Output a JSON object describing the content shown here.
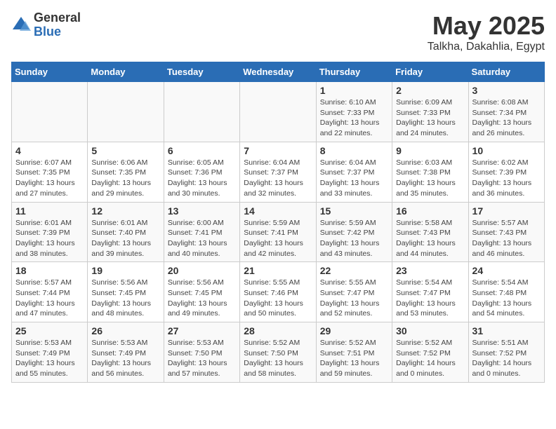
{
  "header": {
    "logo_general": "General",
    "logo_blue": "Blue",
    "month": "May 2025",
    "location": "Talkha, Dakahlia, Egypt"
  },
  "weekdays": [
    "Sunday",
    "Monday",
    "Tuesday",
    "Wednesday",
    "Thursday",
    "Friday",
    "Saturday"
  ],
  "weeks": [
    [
      {
        "day": "",
        "info": ""
      },
      {
        "day": "",
        "info": ""
      },
      {
        "day": "",
        "info": ""
      },
      {
        "day": "",
        "info": ""
      },
      {
        "day": "1",
        "info": "Sunrise: 6:10 AM\nSunset: 7:33 PM\nDaylight: 13 hours\nand 22 minutes."
      },
      {
        "day": "2",
        "info": "Sunrise: 6:09 AM\nSunset: 7:33 PM\nDaylight: 13 hours\nand 24 minutes."
      },
      {
        "day": "3",
        "info": "Sunrise: 6:08 AM\nSunset: 7:34 PM\nDaylight: 13 hours\nand 26 minutes."
      }
    ],
    [
      {
        "day": "4",
        "info": "Sunrise: 6:07 AM\nSunset: 7:35 PM\nDaylight: 13 hours\nand 27 minutes."
      },
      {
        "day": "5",
        "info": "Sunrise: 6:06 AM\nSunset: 7:35 PM\nDaylight: 13 hours\nand 29 minutes."
      },
      {
        "day": "6",
        "info": "Sunrise: 6:05 AM\nSunset: 7:36 PM\nDaylight: 13 hours\nand 30 minutes."
      },
      {
        "day": "7",
        "info": "Sunrise: 6:04 AM\nSunset: 7:37 PM\nDaylight: 13 hours\nand 32 minutes."
      },
      {
        "day": "8",
        "info": "Sunrise: 6:04 AM\nSunset: 7:37 PM\nDaylight: 13 hours\nand 33 minutes."
      },
      {
        "day": "9",
        "info": "Sunrise: 6:03 AM\nSunset: 7:38 PM\nDaylight: 13 hours\nand 35 minutes."
      },
      {
        "day": "10",
        "info": "Sunrise: 6:02 AM\nSunset: 7:39 PM\nDaylight: 13 hours\nand 36 minutes."
      }
    ],
    [
      {
        "day": "11",
        "info": "Sunrise: 6:01 AM\nSunset: 7:39 PM\nDaylight: 13 hours\nand 38 minutes."
      },
      {
        "day": "12",
        "info": "Sunrise: 6:01 AM\nSunset: 7:40 PM\nDaylight: 13 hours\nand 39 minutes."
      },
      {
        "day": "13",
        "info": "Sunrise: 6:00 AM\nSunset: 7:41 PM\nDaylight: 13 hours\nand 40 minutes."
      },
      {
        "day": "14",
        "info": "Sunrise: 5:59 AM\nSunset: 7:41 PM\nDaylight: 13 hours\nand 42 minutes."
      },
      {
        "day": "15",
        "info": "Sunrise: 5:59 AM\nSunset: 7:42 PM\nDaylight: 13 hours\nand 43 minutes."
      },
      {
        "day": "16",
        "info": "Sunrise: 5:58 AM\nSunset: 7:43 PM\nDaylight: 13 hours\nand 44 minutes."
      },
      {
        "day": "17",
        "info": "Sunrise: 5:57 AM\nSunset: 7:43 PM\nDaylight: 13 hours\nand 46 minutes."
      }
    ],
    [
      {
        "day": "18",
        "info": "Sunrise: 5:57 AM\nSunset: 7:44 PM\nDaylight: 13 hours\nand 47 minutes."
      },
      {
        "day": "19",
        "info": "Sunrise: 5:56 AM\nSunset: 7:45 PM\nDaylight: 13 hours\nand 48 minutes."
      },
      {
        "day": "20",
        "info": "Sunrise: 5:56 AM\nSunset: 7:45 PM\nDaylight: 13 hours\nand 49 minutes."
      },
      {
        "day": "21",
        "info": "Sunrise: 5:55 AM\nSunset: 7:46 PM\nDaylight: 13 hours\nand 50 minutes."
      },
      {
        "day": "22",
        "info": "Sunrise: 5:55 AM\nSunset: 7:47 PM\nDaylight: 13 hours\nand 52 minutes."
      },
      {
        "day": "23",
        "info": "Sunrise: 5:54 AM\nSunset: 7:47 PM\nDaylight: 13 hours\nand 53 minutes."
      },
      {
        "day": "24",
        "info": "Sunrise: 5:54 AM\nSunset: 7:48 PM\nDaylight: 13 hours\nand 54 minutes."
      }
    ],
    [
      {
        "day": "25",
        "info": "Sunrise: 5:53 AM\nSunset: 7:49 PM\nDaylight: 13 hours\nand 55 minutes."
      },
      {
        "day": "26",
        "info": "Sunrise: 5:53 AM\nSunset: 7:49 PM\nDaylight: 13 hours\nand 56 minutes."
      },
      {
        "day": "27",
        "info": "Sunrise: 5:53 AM\nSunset: 7:50 PM\nDaylight: 13 hours\nand 57 minutes."
      },
      {
        "day": "28",
        "info": "Sunrise: 5:52 AM\nSunset: 7:50 PM\nDaylight: 13 hours\nand 58 minutes."
      },
      {
        "day": "29",
        "info": "Sunrise: 5:52 AM\nSunset: 7:51 PM\nDaylight: 13 hours\nand 59 minutes."
      },
      {
        "day": "30",
        "info": "Sunrise: 5:52 AM\nSunset: 7:52 PM\nDaylight: 14 hours\nand 0 minutes."
      },
      {
        "day": "31",
        "info": "Sunrise: 5:51 AM\nSunset: 7:52 PM\nDaylight: 14 hours\nand 0 minutes."
      }
    ]
  ]
}
